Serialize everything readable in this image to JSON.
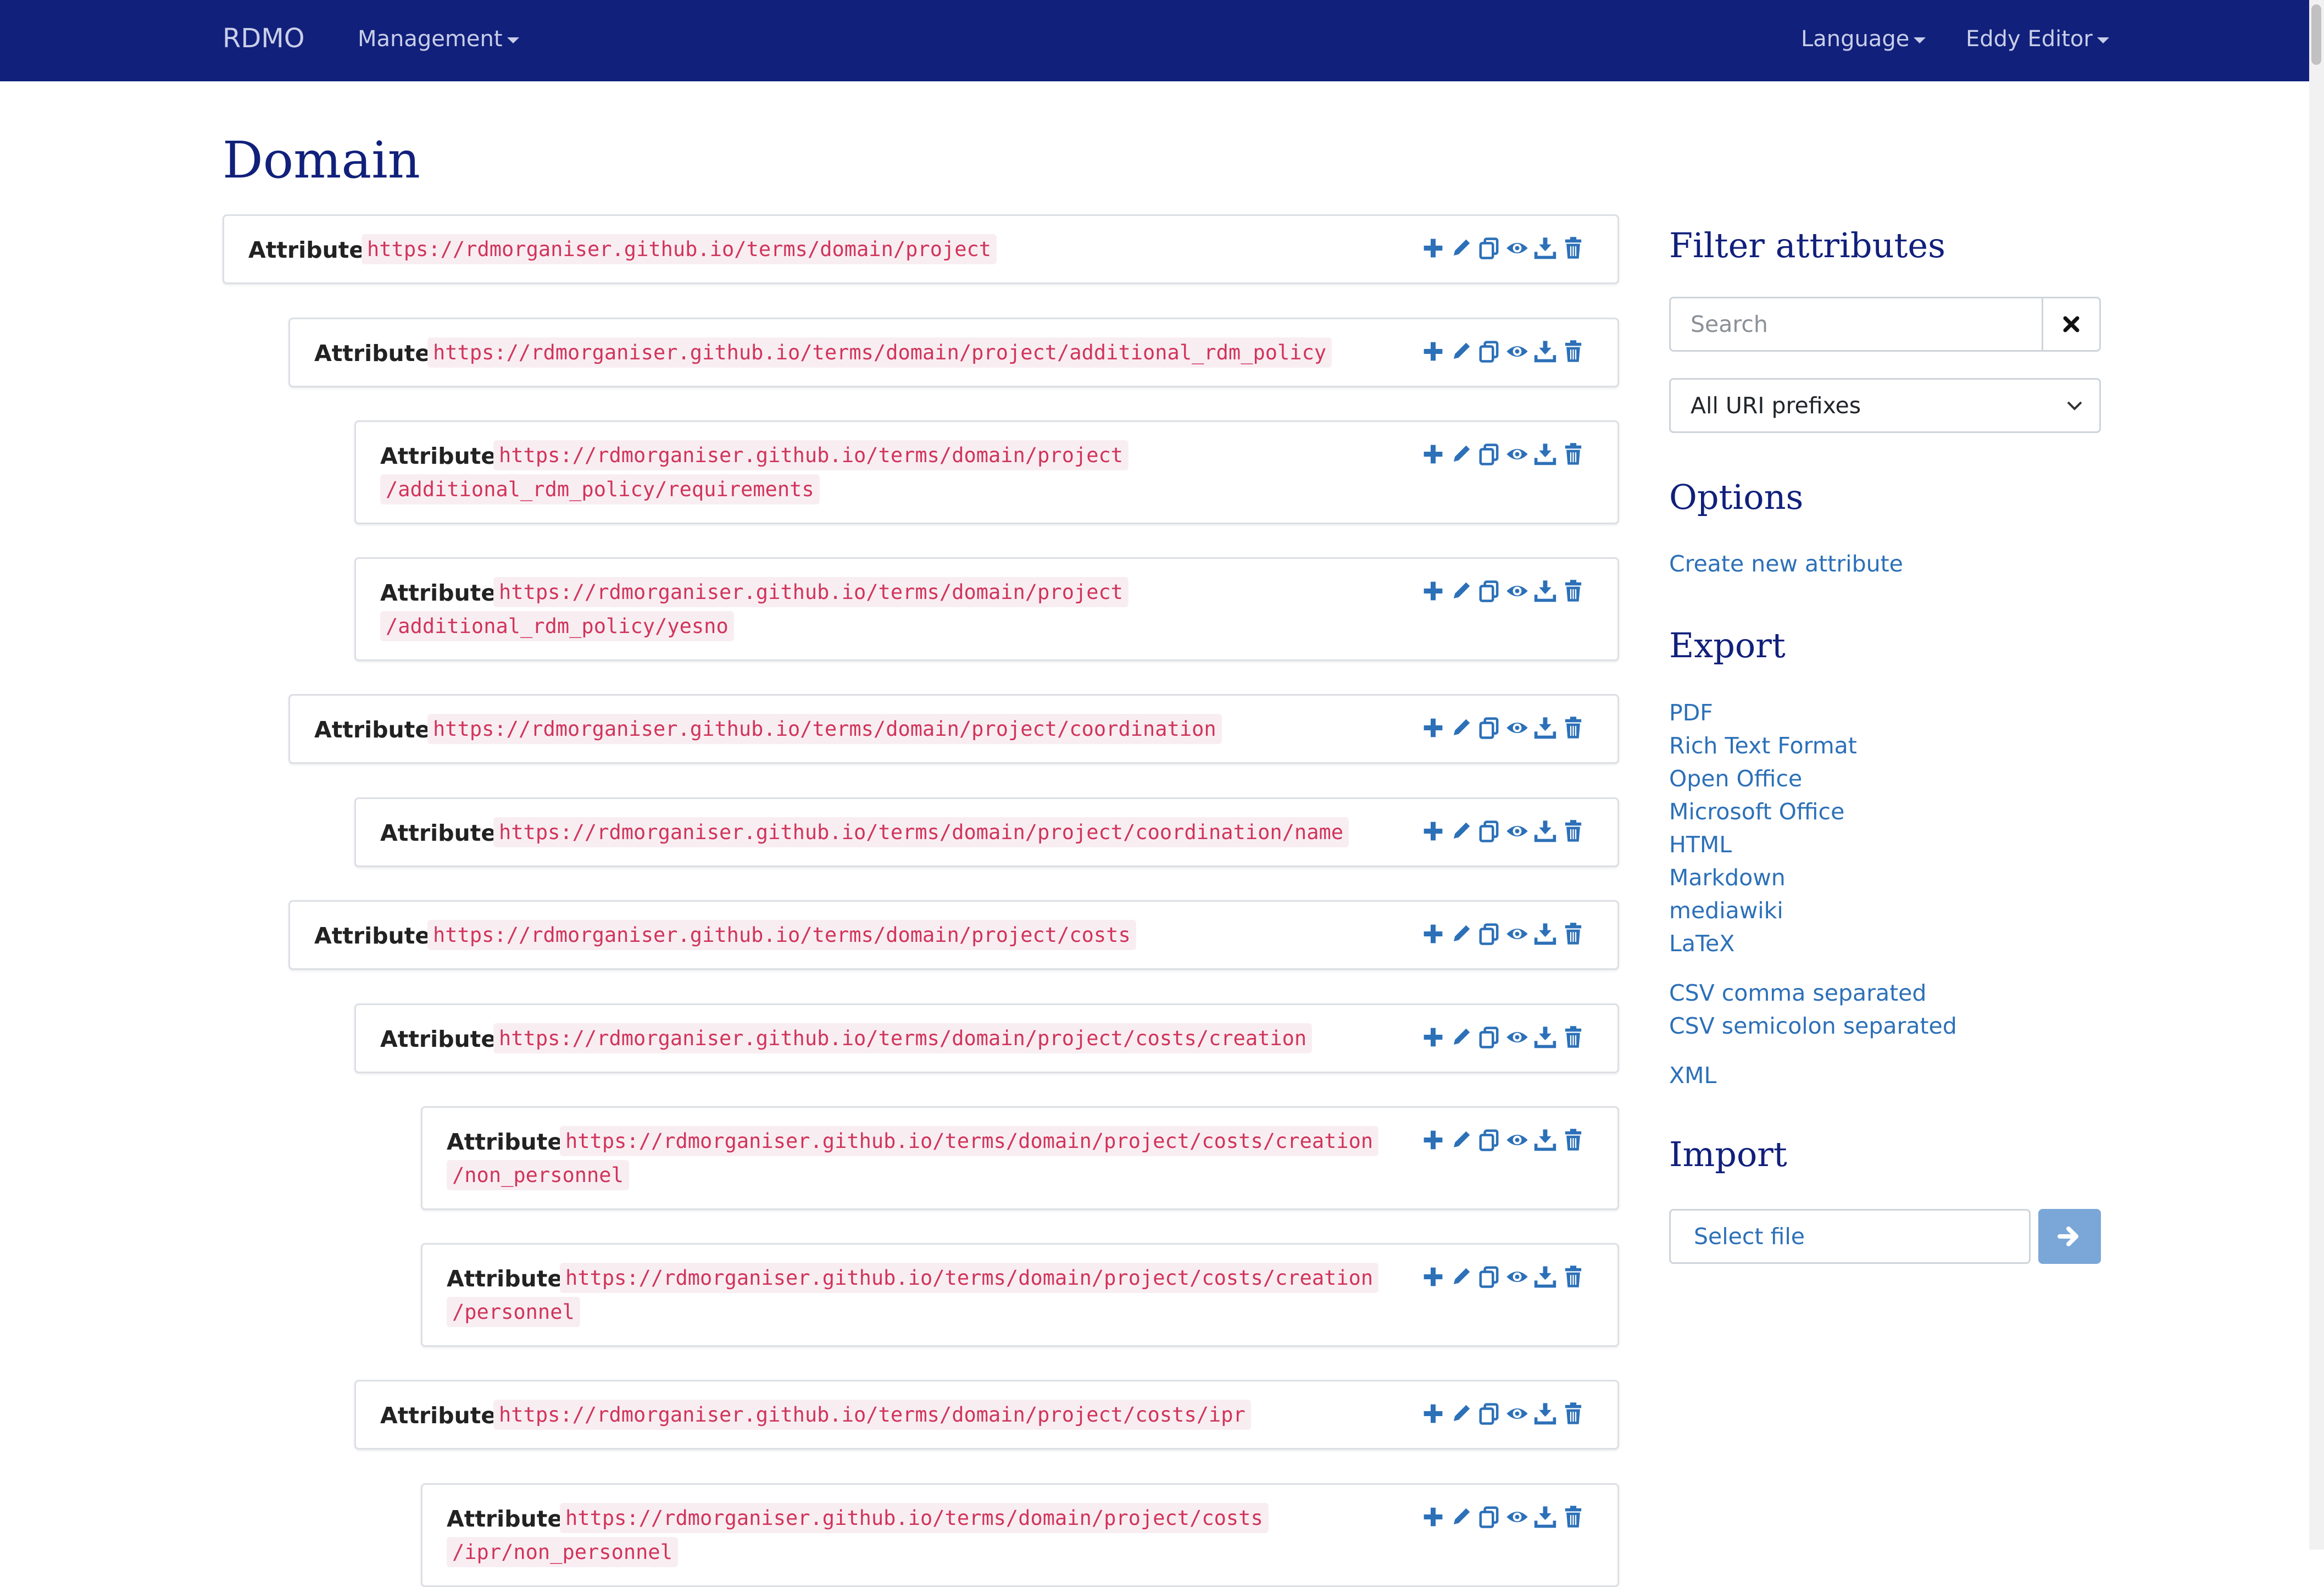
{
  "navbar": {
    "brand": "RDMO",
    "management": "Management",
    "language": "Language",
    "user": "Eddy Editor"
  },
  "page_title": "Domain",
  "attribute_label": "Attribute",
  "attributes": [
    {
      "line1": "https://rdmorganiser.github.io/terms/domain/project",
      "line2": ""
    },
    {
      "line1": "https://rdmorganiser.github.io/terms/domain/project/additional_rdm_policy",
      "line2": ""
    },
    {
      "line1": "https://rdmorganiser.github.io/terms/domain/project",
      "line2": "/additional_rdm_policy/requirements"
    },
    {
      "line1": "https://rdmorganiser.github.io/terms/domain/project",
      "line2": "/additional_rdm_policy/yesno"
    },
    {
      "line1": "https://rdmorganiser.github.io/terms/domain/project/coordination",
      "line2": ""
    },
    {
      "line1": "https://rdmorganiser.github.io/terms/domain/project/coordination/name",
      "line2": ""
    },
    {
      "line1": "https://rdmorganiser.github.io/terms/domain/project/costs",
      "line2": ""
    },
    {
      "line1": "https://rdmorganiser.github.io/terms/domain/project/costs/creation",
      "line2": ""
    },
    {
      "line1": "https://rdmorganiser.github.io/terms/domain/project/costs/creation",
      "line2": "/non_personnel"
    },
    {
      "line1": "https://rdmorganiser.github.io/terms/domain/project/costs/creation",
      "line2": "/personnel"
    },
    {
      "line1": "https://rdmorganiser.github.io/terms/domain/project/costs/ipr",
      "line2": ""
    },
    {
      "line1": "https://rdmorganiser.github.io/terms/domain/project/costs",
      "line2": "/ipr/non_personnel"
    }
  ],
  "action_icons": [
    "plus-icon",
    "pencil-icon",
    "copy-icon",
    "eye-icon",
    "download-icon",
    "trash-icon"
  ],
  "sidebar": {
    "filter_heading": "Filter attributes",
    "search_placeholder": "Search",
    "uri_prefix_selected": "All URI prefixes",
    "options_heading": "Options",
    "create_link": "Create new attribute",
    "export_heading": "Export",
    "export_links": [
      "PDF",
      "Rich Text Format",
      "Open Office",
      "Microsoft Office",
      "HTML",
      "Markdown",
      "mediawiki",
      "LaTeX"
    ],
    "csv_links": [
      "CSV comma separated",
      "CSV semicolon separated"
    ],
    "xml_link": "XML",
    "import_heading": "Import",
    "select_file": "Select file"
  },
  "colors": {
    "navbar": "#11207b",
    "heading": "#11207b",
    "link": "#2c70b8",
    "code": "#d1345b",
    "icon": "#2c70b8"
  }
}
